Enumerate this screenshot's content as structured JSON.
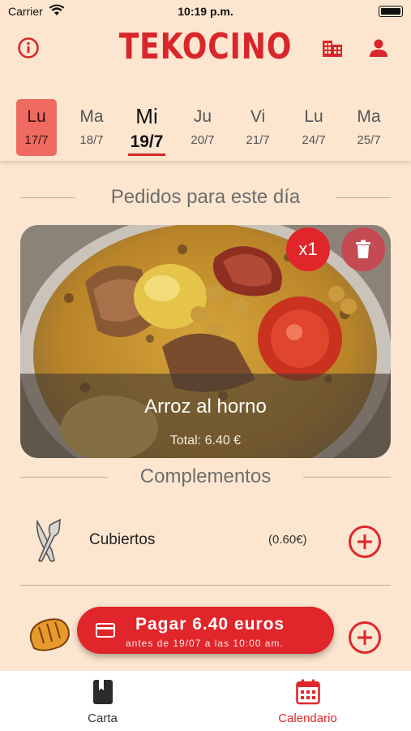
{
  "status": {
    "carrier": "Carrier",
    "time": "10:19 p.m."
  },
  "header": {
    "logo": "TEKOCINO",
    "info_icon": "info-icon",
    "building_icon": "building-icon",
    "user_icon": "user-icon"
  },
  "days": [
    {
      "name": "Lu",
      "date": "17/7",
      "state": "past"
    },
    {
      "name": "Ma",
      "date": "18/7",
      "state": "normal"
    },
    {
      "name": "Mi",
      "date": "19/7",
      "state": "selected"
    },
    {
      "name": "Ju",
      "date": "20/7",
      "state": "normal"
    },
    {
      "name": "Vi",
      "date": "21/7",
      "state": "normal"
    },
    {
      "name": "Lu",
      "date": "24/7",
      "state": "normal"
    },
    {
      "name": "Ma",
      "date": "25/7",
      "state": "normal"
    }
  ],
  "orders_section": {
    "title": "Pedidos para este día"
  },
  "order": {
    "name": "Arroz al horno",
    "total": "Total: 6.40 €",
    "quantity": "x1"
  },
  "complements_section": {
    "title": "Complementos"
  },
  "complements": [
    {
      "name": "Cubiertos",
      "price": "(0.60€)",
      "icon": "cutlery-icon"
    },
    {
      "name": "",
      "price": "",
      "icon": "bread-icon"
    }
  ],
  "pay": {
    "label": "Pagar 6.40 euros",
    "sublabel": "antes de 19/07 a las 10:00 am."
  },
  "tabs": [
    {
      "label": "Carta",
      "icon": "menu-book-icon",
      "active": false
    },
    {
      "label": "Calendario",
      "icon": "calendar-icon",
      "active": true
    }
  ],
  "colors": {
    "accent": "#e0262b",
    "background": "#fde6d0",
    "past_day": "#ef6a61"
  }
}
